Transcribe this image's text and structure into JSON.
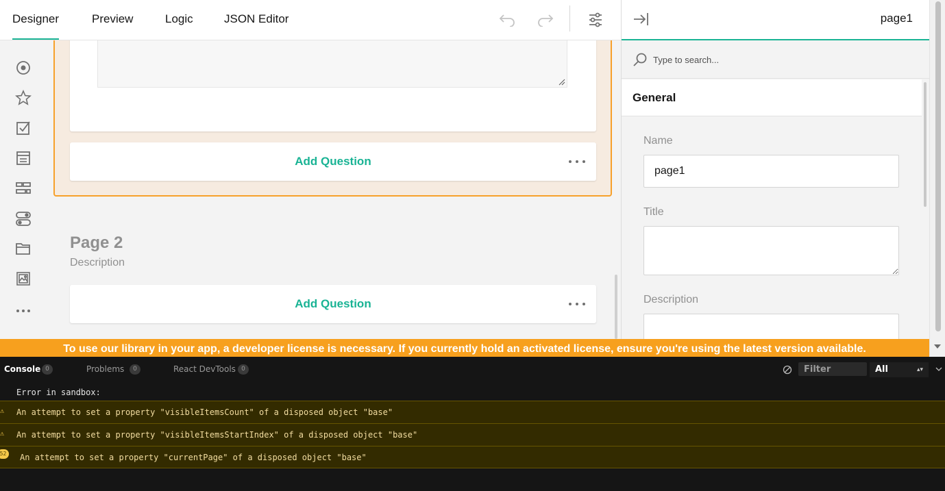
{
  "topbar": {
    "tabs": [
      {
        "label": "Designer"
      },
      {
        "label": "Preview"
      },
      {
        "label": "Logic"
      },
      {
        "label": "JSON Editor"
      }
    ]
  },
  "toolbox": {
    "items": [
      "radiogroup-icon",
      "rating-icon",
      "checkbox-icon",
      "panel-icon",
      "text-icon",
      "boolean-icon",
      "folder-icon",
      "image-icon",
      "more-icon"
    ]
  },
  "surface": {
    "page1": {
      "add_question": "Add Question"
    },
    "page2": {
      "title": "Page 2",
      "description": "Description",
      "add_question": "Add Question"
    }
  },
  "panel": {
    "header_title": "page1",
    "search_placeholder": "Type to search...",
    "section": "General",
    "name_label": "Name",
    "name_value": "page1",
    "title_label": "Title",
    "title_value": "",
    "description_label": "Description"
  },
  "banner": {
    "text": "To use our library in your app, a developer license is necessary. If you currently hold an activated license, ensure you're using the latest version available."
  },
  "console": {
    "tabs": [
      {
        "label": "Console",
        "count": "0"
      },
      {
        "label": "Problems",
        "count": "0"
      },
      {
        "label": "React DevTools",
        "count": "0"
      }
    ],
    "filter_placeholder": "Filter",
    "level": "All",
    "rows": [
      {
        "type": "plain",
        "text": "Error in sandbox:"
      },
      {
        "type": "warn",
        "text": "An attempt to set a property \"visibleItemsCount\" of a disposed object \"base\""
      },
      {
        "type": "warn",
        "text": "An attempt to set a property \"visibleItemsStartIndex\" of a disposed object \"base\""
      },
      {
        "type": "warn",
        "count": "52",
        "text": "An attempt to set a property \"currentPage\" of a disposed object \"base\""
      }
    ]
  },
  "colors": {
    "accent": "#19b394",
    "selection": "#f7a02a",
    "banner": "#f7a01e"
  }
}
